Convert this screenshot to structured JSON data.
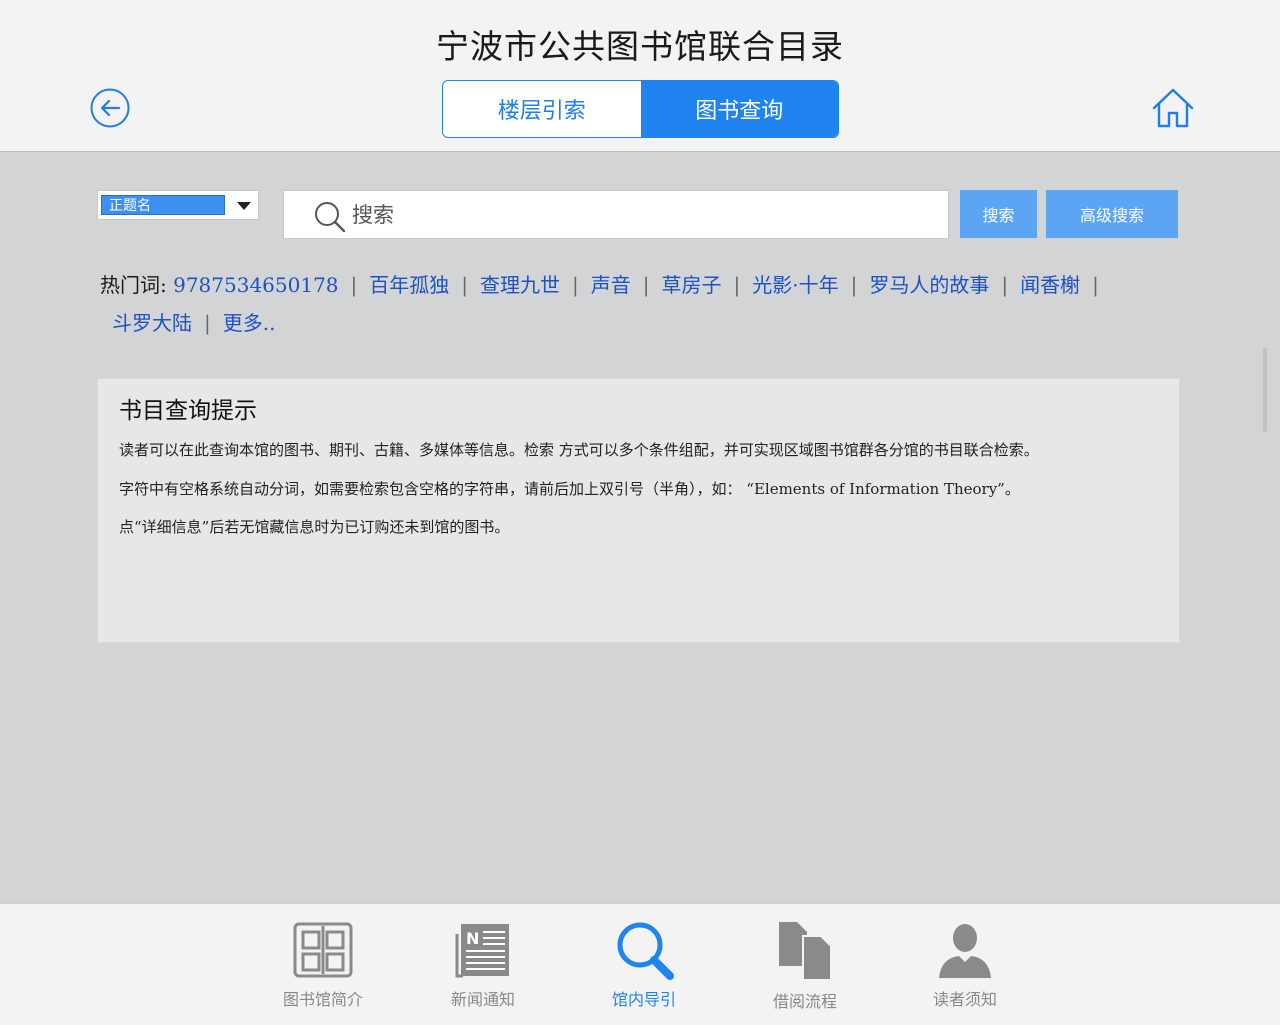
{
  "header": {
    "title": "宁波市公共图书馆联合目录",
    "back_icon": "back-arrow-icon",
    "home_icon": "home-icon",
    "tabs": [
      {
        "label": "楼层引索",
        "active": false
      },
      {
        "label": "图书查询",
        "active": true
      }
    ]
  },
  "search": {
    "field_selected": "正题名",
    "placeholder": "搜索",
    "value": "",
    "search_button": "搜索",
    "advanced_button": "高级搜索"
  },
  "hot": {
    "label": "热门词:",
    "items": [
      "9787534650178",
      "百年孤独",
      "查理九世",
      "声音",
      "草房子",
      "光影·十年",
      "罗马人的故事",
      "闻香榭",
      "斗罗大陆",
      "更多.."
    ]
  },
  "tips": {
    "title": "书目查询提示",
    "lines": [
      "读者可以在此查询本馆的图书、期刊、古籍、多媒体等信息。检索 方式可以多个条件组配，并可实现区域图书馆群各分馆的书目联合检索。",
      "字符中有空格系统自动分词，如需要检索包含空格的字符串，请前后加上双引号（半角），如： “Elements of Information Theory”。",
      "点“详细信息”后若无馆藏信息时为已订购还未到馆的图书。"
    ]
  },
  "tabbar": [
    {
      "label": "图书馆简介",
      "icon": "library-intro-icon",
      "active": false
    },
    {
      "label": "新闻通知",
      "icon": "newspaper-icon",
      "active": false
    },
    {
      "label": "馆内导引",
      "icon": "search-icon",
      "active": true
    },
    {
      "label": "借阅流程",
      "icon": "documents-icon",
      "active": false
    },
    {
      "label": "读者须知",
      "icon": "user-icon",
      "active": false
    }
  ],
  "colors": {
    "accent": "#1f84f0",
    "button": "#5ca5f2",
    "link": "#1c52c4",
    "inactive": "#888888"
  }
}
